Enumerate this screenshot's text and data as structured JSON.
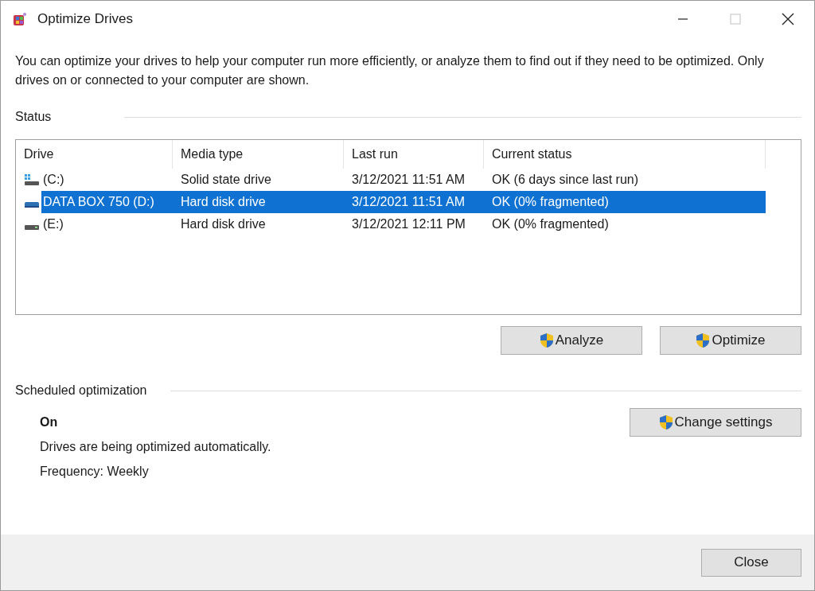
{
  "window": {
    "title": "Optimize Drives",
    "title_buttons": [
      {
        "kind": "minimize",
        "disabled": false
      },
      {
        "kind": "maximize",
        "disabled": true
      },
      {
        "kind": "close",
        "disabled": false
      }
    ]
  },
  "description": "You can optimize your drives to help your computer run more efficiently, or analyze them to find out if they need to be optimized. Only drives on or connected to your computer are shown.",
  "status": {
    "heading": "Status",
    "table": {
      "columns": [
        "Drive",
        "Media type",
        "Last run",
        "Current status"
      ],
      "rows": [
        {
          "kind": "system",
          "selected": false,
          "cells": [
            "(C:)",
            "Solid state drive",
            "3/12/2021 11:51 AM",
            "OK (6 days since last run)"
          ]
        },
        {
          "kind": "external",
          "selected": true,
          "cells": [
            "DATA BOX 750 (D:)",
            "Hard disk drive",
            "3/12/2021 11:51 AM",
            "OK (0% fragmented)"
          ]
        },
        {
          "kind": "disk",
          "selected": false,
          "cells": [
            "(E:)",
            "Hard disk drive",
            "3/12/2021 12:11 PM",
            "OK (0% fragmented)"
          ]
        }
      ]
    },
    "buttons": [
      "Analyze",
      "Optimize"
    ]
  },
  "scheduled": {
    "heading": "Scheduled optimization",
    "state": "On",
    "note": "Drives are being optimized automatically.",
    "frequency": "Frequency: Weekly",
    "button": "Change settings"
  },
  "footer": {
    "button": "Close"
  }
}
